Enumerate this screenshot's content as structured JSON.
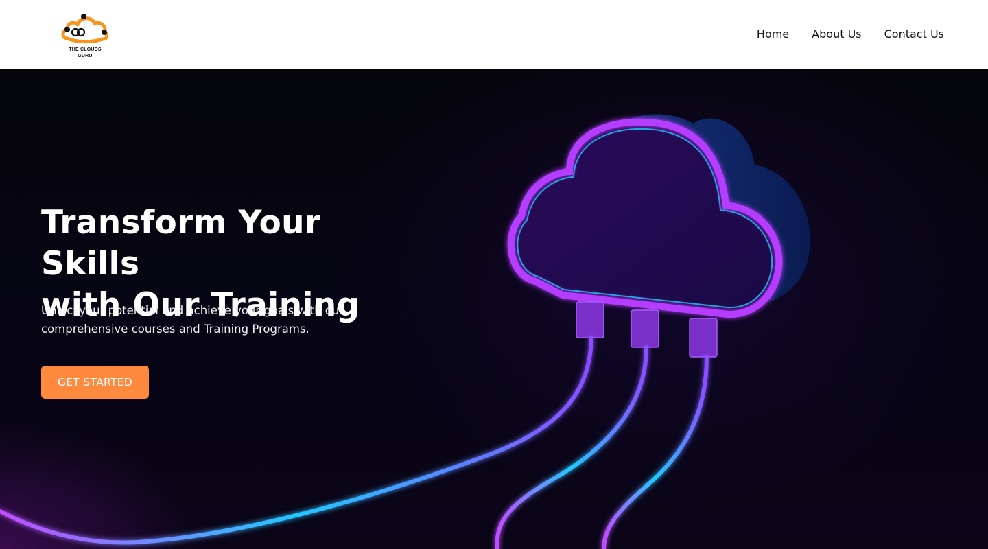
{
  "brand": {
    "logo_text_line1": "THE CLOUDS",
    "logo_text_line2": "GURU",
    "accent_color": "#ff8a3d"
  },
  "nav": {
    "items": [
      {
        "label": "Home"
      },
      {
        "label": "About Us"
      },
      {
        "label": "Contact Us"
      }
    ]
  },
  "hero": {
    "headline_line1": "Transform Your Skills",
    "headline_line2": "with Our Training",
    "subtext": "Unlockyour potential and achieve your goals with our comprehensive courses and Training Programs.",
    "cta_label": "GET STARTED",
    "illustration": "neon-cloud-with-cables"
  }
}
